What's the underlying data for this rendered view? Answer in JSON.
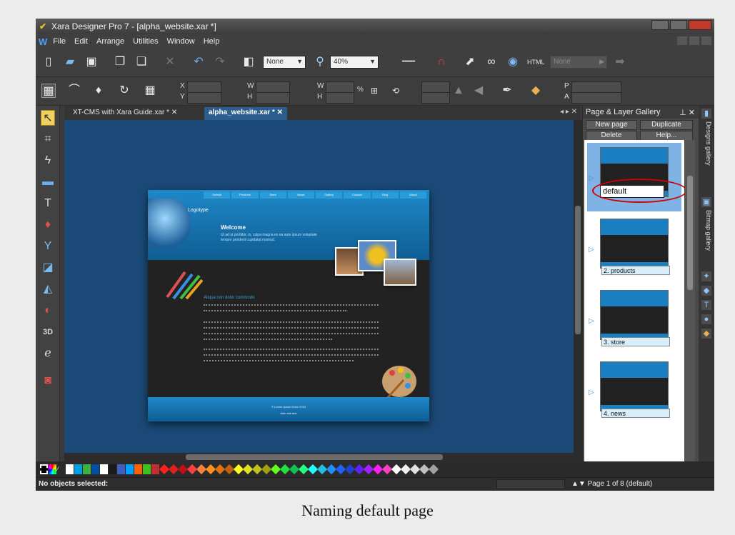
{
  "window": {
    "title": "Xara Designer Pro 7 - [alpha_website.xar *]"
  },
  "menu": [
    "File",
    "Edit",
    "Arrange",
    "Utilities",
    "Window",
    "Help"
  ],
  "toolbar": {
    "fill_combo": "None",
    "zoom_combo": "40%",
    "none_combo": "None",
    "labels": {
      "x": "X",
      "y": "Y",
      "w1": "W",
      "h1": "H",
      "w2": "W",
      "h2": "H",
      "p": "P",
      "a": "A",
      "pct": "%"
    }
  },
  "tabs": [
    {
      "label": "XT-CMS with Xara Guide.xar *",
      "active": false
    },
    {
      "label": "alpha_website.xar *",
      "active": true
    }
  ],
  "webpage": {
    "nav": [
      "Default",
      "Products",
      "Store",
      "News",
      "Gallery",
      "Contact",
      "Blog",
      "About"
    ],
    "logo": "Logotype",
    "welcome": "Welcome",
    "subtitle": "Ut ad ut porttitor, in, culpa magna ex ea aute ipsum voluptate tempor proident cupidatat nostrud.",
    "heading": "Aliqua non dolor commodo",
    "footer1": "© Lorem Ipsum Dolor 2010",
    "footer2": "Web site text"
  },
  "gallery": {
    "title": "Page & Layer Gallery",
    "buttons": {
      "new_page": "New page",
      "duplicate": "Duplicate",
      "delete": "Delete",
      "help": "Help..."
    },
    "items": [
      {
        "name": "default",
        "selected": true
      },
      {
        "name": "2. products",
        "selected": false
      },
      {
        "name": "3. store",
        "selected": false
      },
      {
        "name": "4. news",
        "selected": false
      }
    ],
    "callout_text": "default"
  },
  "side_tabs": {
    "designs": "Designs gallery",
    "bitmap": "Bitmap gallery"
  },
  "status": {
    "left": "No objects selected:",
    "right": "▲▼ Page 1 of 8 (default)"
  },
  "caption": "Naming default page",
  "colors": {
    "canvas": "#1b4a78",
    "highlight_ring": "#d00000",
    "swatches": [
      "#ffffff",
      "#00a0e0",
      "#40b040",
      "#0050a0",
      "#ffffff",
      "#1a1a1a",
      "#4060c0",
      "#00a0ff",
      "#ff6000",
      "#40c020",
      "#c03030"
    ],
    "diamonds": [
      "#ff2020",
      "#e02020",
      "#c01010",
      "#ff4040",
      "#ff8040",
      "#ff9020",
      "#e07010",
      "#c06010",
      "#ffff20",
      "#e0e020",
      "#c0c020",
      "#a0a010",
      "#60ff20",
      "#20e040",
      "#10c050",
      "#20ff80",
      "#20ffff",
      "#20c0e0",
      "#2090ff",
      "#2060ff",
      "#2040d0",
      "#6020ff",
      "#a020ff",
      "#ff20ff",
      "#ff40c0",
      "#ffffff",
      "#f0f0f0",
      "#e0e0e0",
      "#c0c0c0",
      "#a0a0a0"
    ]
  }
}
